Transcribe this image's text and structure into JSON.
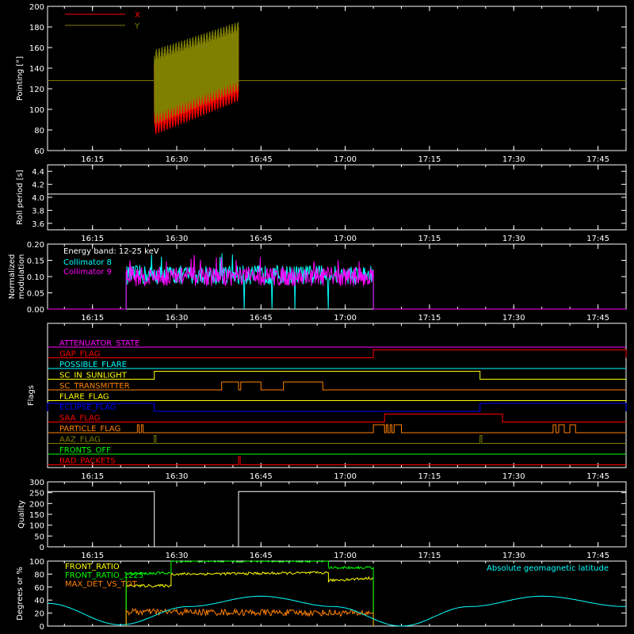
{
  "chart_data": [
    {
      "type": "line",
      "ylabel": "Pointing [°]",
      "ylim": [
        60,
        200
      ],
      "yticks": [
        "60",
        "80",
        "100",
        "120",
        "140",
        "160",
        "180",
        "200"
      ],
      "xticks": [
        "16:15",
        "16:30",
        "16:45",
        "17:00",
        "17:15",
        "17:30",
        "17:45"
      ],
      "xlim": [
        "16:07",
        "17:50"
      ],
      "legend": [
        {
          "name": "X",
          "color": "#ff0000"
        },
        {
          "name": "Y",
          "color": "#808000"
        }
      ],
      "legend_placement": "top-left",
      "series": [
        {
          "name": "X",
          "color": "#ff0000",
          "t_start": "16:26",
          "t_end": "16:41",
          "y_low_start": 75,
          "y_low_end": 108,
          "y_high_start": 150,
          "y_high_end": 178,
          "oscillation_period_min": 0.5
        },
        {
          "name": "Y",
          "color": "#808000",
          "t_start": "16:26",
          "t_end": "16:41",
          "y_low_start": 85,
          "y_low_end": 118,
          "y_high_start": 158,
          "y_high_end": 185,
          "oscillation_period_min": 0.5
        }
      ],
      "reference_line": {
        "y": 128,
        "color": "#808000"
      }
    },
    {
      "type": "line",
      "ylabel": "Roll period [s]",
      "ylim": [
        3.5,
        4.5
      ],
      "yticks": [
        "3.6",
        "3.8",
        "4.0",
        "4.2",
        "4.4"
      ],
      "xticks": [
        "16:15",
        "16:30",
        "16:45",
        "17:00",
        "17:15",
        "17:30",
        "17:45"
      ],
      "series": [
        {
          "name": "",
          "color": "#ffffff",
          "constant": 4.05
        }
      ]
    },
    {
      "type": "line",
      "ylabel": "Normalized modulation",
      "ylim": [
        0,
        0.2
      ],
      "yticks": [
        "0.00",
        "0.05",
        "0.10",
        "0.15",
        "0.20"
      ],
      "xticks": [
        "16:15",
        "16:30",
        "16:45",
        "17:00",
        "17:15",
        "17:30",
        "17:45"
      ],
      "annotation": "Energy band: 12-25 keV",
      "legend": [
        {
          "name": "Collimator 8",
          "color": "#00ffff"
        },
        {
          "name": "Collimator 9",
          "color": "#ff00ff"
        }
      ],
      "series": [
        {
          "name": "Collimator 8",
          "color": "#00ffff",
          "t_start": "16:21",
          "t_end": "17:05",
          "mean": 0.105,
          "spread": 0.03,
          "dropouts": [
            "16:42",
            "16:47",
            "16:51",
            "16:57"
          ]
        },
        {
          "name": "Collimator 9",
          "color": "#ff00ff",
          "t_start": "16:21",
          "t_end": "17:05",
          "mean": 0.1,
          "spread": 0.03
        }
      ]
    },
    {
      "type": "line",
      "ylabel": "Flags",
      "xticks": [
        "16:15",
        "16:30",
        "16:45",
        "17:00",
        "17:15",
        "17:30",
        "17:45"
      ],
      "flags": [
        {
          "name": "ATTENUATOR_STATE",
          "color": "#ff00ff",
          "segments": []
        },
        {
          "name": "GAP_FLAG",
          "color": "#ff0000",
          "segments": [
            [
              "17:05",
              "17:50"
            ]
          ]
        },
        {
          "name": "POSSIBLE_FLARE",
          "color": "#00ffff",
          "segments": []
        },
        {
          "name": "SC_IN_SUNLIGHT",
          "color": "#ffff00",
          "segments": [
            [
              "16:26",
              "17:24"
            ]
          ]
        },
        {
          "name": "SC_TRANSMITTER",
          "color": "#ff8000",
          "segments": [
            [
              "16:38",
              "16:41"
            ],
            [
              "16:41.4",
              "16:45"
            ],
            [
              "16:49",
              "16:56"
            ]
          ]
        },
        {
          "name": "FLARE_FLAG",
          "color": "#ffff00",
          "segments": []
        },
        {
          "name": "ECLIPSE_FLAG",
          "color": "#0000ff",
          "segments": [
            [
              "16:07",
              "16:26"
            ],
            [
              "17:24",
              "17:50"
            ]
          ]
        },
        {
          "name": "SAA_FLAG",
          "color": "#ff0000",
          "segments": [
            [
              "17:07",
              "17:28"
            ]
          ]
        },
        {
          "name": "PARTICLE_FLAG",
          "color": "#ff8000",
          "segments": [
            [
              "16:23",
              "16:23.3"
            ],
            [
              "16:23.7",
              "16:24"
            ],
            [
              "17:05",
              "17:07"
            ],
            [
              "17:07.3",
              "17:07.6"
            ],
            [
              "17:08",
              "17:08.3"
            ],
            [
              "17:08.7",
              "17:10"
            ],
            [
              "17:37",
              "17:37.5"
            ],
            [
              "17:38",
              "17:39"
            ],
            [
              "17:40",
              "17:41"
            ]
          ]
        },
        {
          "name": "AAZ_FLAG",
          "color": "#808000",
          "segments": [
            [
              "16:26",
              "16:26.3"
            ],
            [
              "17:24",
              "17:24.3"
            ]
          ]
        },
        {
          "name": "FRONTS_OFF",
          "color": "#00ff00",
          "segments": []
        },
        {
          "name": "BAD_PACKETS",
          "color": "#ff0000",
          "segments": [
            [
              "16:41",
              "16:41.3"
            ]
          ]
        }
      ]
    },
    {
      "type": "line",
      "ylabel": "Quality",
      "ylim": [
        0,
        300
      ],
      "yticks": [
        "0",
        "50",
        "100",
        "150",
        "200",
        "250",
        "300"
      ],
      "xticks": [
        "16:15",
        "16:30",
        "16:45",
        "17:00",
        "17:15",
        "17:30",
        "17:45"
      ],
      "series": [
        {
          "name": "",
          "color": "#ffffff",
          "points": [
            [
              "16:07",
              255
            ],
            [
              "16:26",
              255
            ],
            [
              "16:26",
              0
            ],
            [
              "16:41",
              0
            ],
            [
              "16:41",
              255
            ],
            [
              "17:50",
              255
            ]
          ]
        }
      ]
    },
    {
      "type": "line",
      "ylabel": "Degrees or %",
      "ylim": [
        0,
        100
      ],
      "yticks": [
        "0",
        "20",
        "40",
        "60",
        "80",
        "100"
      ],
      "legend": [
        {
          "name": "FRONT_RATIO",
          "color": "#ffff00"
        },
        {
          "name": "FRONT_RATIO_1225",
          "color": "#00ff00"
        },
        {
          "name": "MAX_DET_VS_TOT",
          "color": "#ff8000"
        }
      ],
      "annotation": "Absolute geomagnetic latitude",
      "annotation_color": "#00ffff",
      "series": [
        {
          "name": "FRONT_RATIO",
          "color": "#ffff00",
          "points": [
            [
              "16:21",
              0
            ],
            [
              "16:21",
              62
            ],
            [
              "16:29",
              62
            ],
            [
              "16:29",
              80
            ],
            [
              "16:57",
              82
            ],
            [
              "16:57",
              70
            ],
            [
              "17:05",
              74
            ],
            [
              "17:05",
              0
            ]
          ]
        },
        {
          "name": "FRONT_RATIO_1225",
          "color": "#00ff00",
          "points": [
            [
              "16:21",
              0
            ],
            [
              "16:21",
              80
            ],
            [
              "16:29",
              82
            ],
            [
              "16:29",
              100
            ],
            [
              "16:57",
              100
            ],
            [
              "16:57",
              90
            ],
            [
              "17:05",
              90
            ],
            [
              "17:05",
              0
            ]
          ]
        },
        {
          "name": "MAX_DET_VS_TOT",
          "color": "#ff8000",
          "points": [
            [
              "16:21",
              0
            ],
            [
              "16:21",
              22
            ],
            [
              "17:05",
              20
            ],
            [
              "17:05",
              0
            ]
          ]
        },
        {
          "name": "Absolute geomagnetic latitude",
          "color": "#00ffff",
          "points": [
            [
              "16:07",
              35
            ],
            [
              "16:20",
              2
            ],
            [
              "16:32",
              30
            ],
            [
              "16:45",
              46
            ],
            [
              "16:58",
              30
            ],
            [
              "17:10",
              0
            ],
            [
              "17:22",
              30
            ],
            [
              "17:35",
              46
            ],
            [
              "17:50",
              30
            ]
          ]
        }
      ]
    }
  ]
}
